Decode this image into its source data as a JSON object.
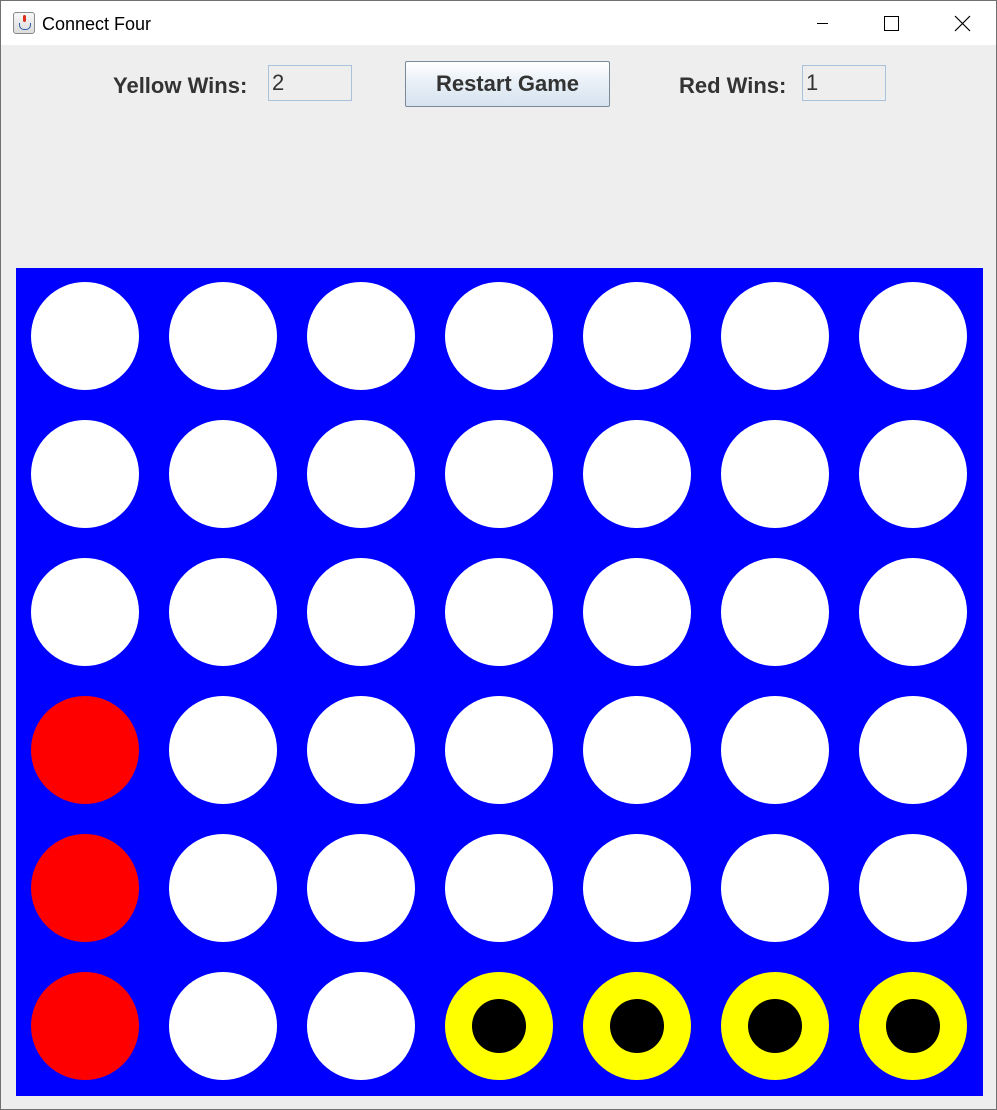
{
  "window": {
    "title": "Connect Four",
    "icon": "java-cup-icon"
  },
  "controls": {
    "yellow_wins_label": "Yellow Wins:",
    "yellow_wins_value": "2",
    "restart_label": "Restart Game",
    "red_wins_label": "Red Wins:",
    "red_wins_value": "1"
  },
  "colors": {
    "board": "#0000ff",
    "empty": "#ffffff",
    "red": "#ff0000",
    "yellow": "#ffff00",
    "winning_marker": "#000000"
  },
  "board": {
    "rows": 6,
    "columns": 7,
    "grid": [
      [
        "empty",
        "empty",
        "empty",
        "empty",
        "empty",
        "empty",
        "empty"
      ],
      [
        "empty",
        "empty",
        "empty",
        "empty",
        "empty",
        "empty",
        "empty"
      ],
      [
        "empty",
        "empty",
        "empty",
        "empty",
        "empty",
        "empty",
        "empty"
      ],
      [
        "red",
        "empty",
        "empty",
        "empty",
        "empty",
        "empty",
        "empty"
      ],
      [
        "red",
        "empty",
        "empty",
        "empty",
        "empty",
        "empty",
        "empty"
      ],
      [
        "red",
        "empty",
        "empty",
        "yellow",
        "yellow",
        "yellow",
        "yellow"
      ]
    ],
    "winning_cells": [
      [
        5,
        3
      ],
      [
        5,
        4
      ],
      [
        5,
        5
      ],
      [
        5,
        6
      ]
    ]
  }
}
